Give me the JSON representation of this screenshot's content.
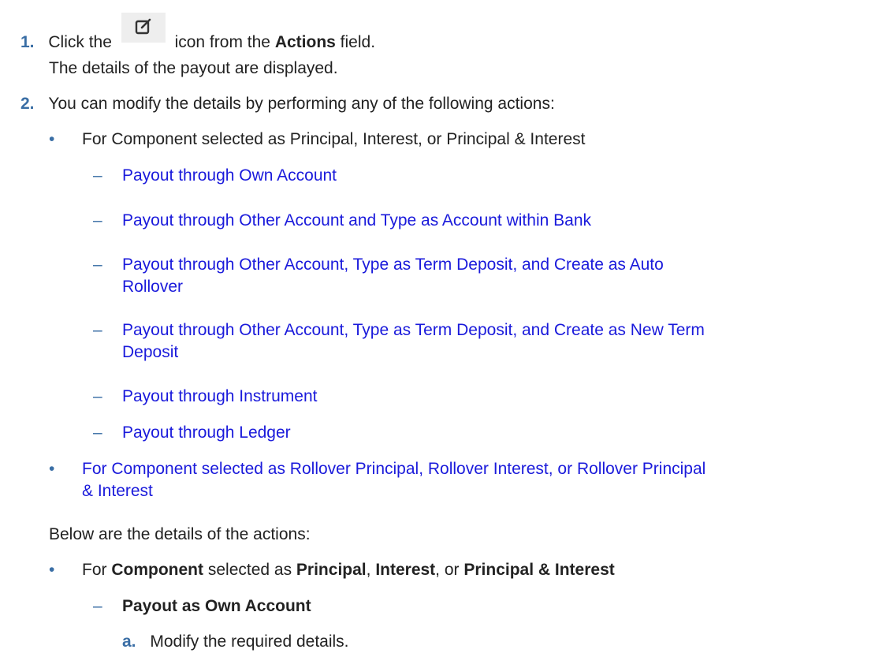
{
  "step1": {
    "number": "1.",
    "prefix": "Click the",
    "icon": "edit-icon",
    "suffix": "icon from the",
    "field": "Actions",
    "field_suffix": "field.",
    "result": "The details of the payout are displayed."
  },
  "step2": {
    "number": "2.",
    "text": "You can modify the details by performing any of the following actions:",
    "group1_label": "For Component selected as Principal, Interest, or Principal & Interest",
    "links": [
      "Payout through Own Account",
      "Payout through Other Account and Type as Account within Bank",
      "Payout through Other Account, Type as Term Deposit, and Create as Auto",
      "Rollover",
      "Payout through Other Account, Type as Term Deposit, and Create as New Term",
      "Deposit",
      "Payout through Instrument",
      "Payout through Ledger"
    ],
    "group2_link_line1": "For Component selected as Rollover Principal, Rollover Interest, or Rollover Principal",
    "group2_link_line2": "& Interest"
  },
  "details": {
    "intro": "Below are the details of the actions:",
    "bullet": {
      "for": "For",
      "component": "Component",
      "selected_as": "selected as",
      "principal": "Principal",
      "comma1": ",",
      "interest": "Interest",
      "comma_or": ", or",
      "principal_interest": "Principal & Interest"
    },
    "subheading": "Payout as Own Account",
    "substep_letter": "a.",
    "substep_text": "Modify the required details."
  },
  "markers": {
    "bullet": "•",
    "dash": "–"
  },
  "colors": {
    "link": "#1a1adb",
    "number": "#3a6ea5",
    "text": "#222222"
  }
}
